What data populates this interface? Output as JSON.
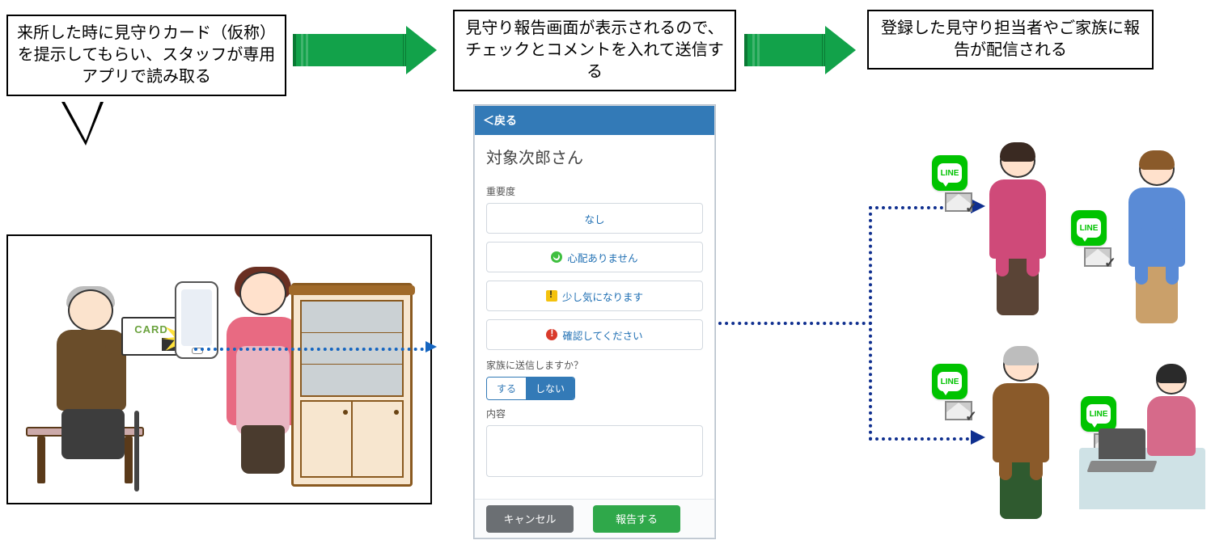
{
  "captions": {
    "left": "来所した時に見守りカード（仮称）を提示してもらい、スタッフが専用アプリで読み取る",
    "middle": "見守り報告画面が表示されるので、チェックとコメントを入れて送信する",
    "right": "登録した見守り担当者やご家族に報告が配信される"
  },
  "card_label": "CARD",
  "line_label": "LINE",
  "app": {
    "back": "＜戻る",
    "person": "対象次郎さん",
    "severity_label": "重要度",
    "options": {
      "none": "なし",
      "ok": "心配ありません",
      "warn": "少し気になります",
      "alert": "確認してください"
    },
    "send_family_label": "家族に送信しますか？",
    "send_yes": "する",
    "send_no": "しない",
    "content_label": "内容",
    "cancel": "キャンセル",
    "submit": "報告する"
  }
}
